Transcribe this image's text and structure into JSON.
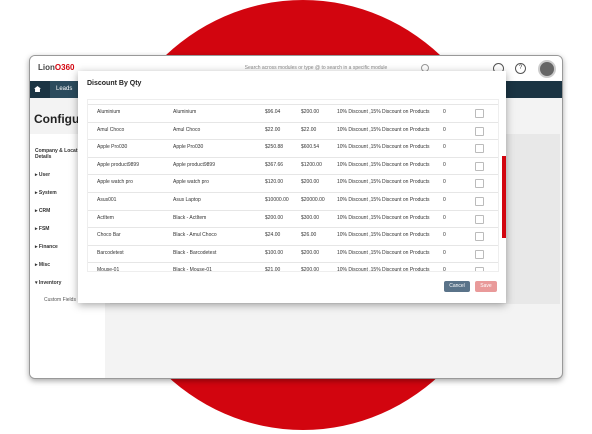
{
  "app": {
    "logo_prefix": "Lion",
    "logo_suffix": "O360",
    "search_placeholder": "Search across modules or type @ to search in a specific module",
    "help_label": "?",
    "nav_item": "Leads",
    "page_title": "Configura"
  },
  "sidebar": {
    "items": [
      {
        "label": "Company & Locat Details"
      },
      {
        "label": "User"
      },
      {
        "label": "System"
      },
      {
        "label": "CRM"
      },
      {
        "label": "FSM"
      },
      {
        "label": "Finance"
      },
      {
        "label": "Misc"
      },
      {
        "label": "Inventory"
      },
      {
        "label": "Custom Fields"
      }
    ]
  },
  "modal": {
    "title": "Discount By Qty",
    "rows": [
      {
        "name": "Aluminium",
        "alias": "Aluminium",
        "price1": "$96.04",
        "price2": "$200.00",
        "discount": "10% Discount ,15% Discount on Products",
        "qty": "0"
      },
      {
        "name": "Amul Choco",
        "alias": "Amul Choco",
        "price1": "$22.00",
        "price2": "$22.00",
        "discount": "10% Discount ,15% Discount on Products",
        "qty": "0"
      },
      {
        "name": "Apple Pro030",
        "alias": "Apple Pro030",
        "price1": "$250.88",
        "price2": "$600.54",
        "discount": "10% Discount ,15% Discount on Products",
        "qty": "0"
      },
      {
        "name": "Apple product9899",
        "alias": "Apple product9899",
        "price1": "$367.66",
        "price2": "$1200.00",
        "discount": "10% Discount ,15% Discount on Products",
        "qty": "0"
      },
      {
        "name": "Apple watch pro",
        "alias": "Apple watch pro",
        "price1": "$120.00",
        "price2": "$200.00",
        "discount": "10% Discount ,15% Discount on Products",
        "qty": "0"
      },
      {
        "name": "Asus001",
        "alias": "Asus Laptop",
        "price1": "$10000.00",
        "price2": "$20000.00",
        "discount": "10% Discount ,15% Discount on Products",
        "qty": "0"
      },
      {
        "name": "ActItem",
        "alias": "Black - ActItem",
        "price1": "$200.00",
        "price2": "$300.00",
        "discount": "10% Discount ,15% Discount on Products",
        "qty": "0"
      },
      {
        "name": "Choco Bar",
        "alias": "Black - Amul Choco",
        "price1": "$24.00",
        "price2": "$26.00",
        "discount": "10% Discount ,15% Discount on Products",
        "qty": "0"
      },
      {
        "name": "Barcodetest",
        "alias": "Black - Barcodetest",
        "price1": "$100.00",
        "price2": "$200.00",
        "discount": "10% Discount ,15% Discount on Products",
        "qty": "0"
      },
      {
        "name": "Mouse-01",
        "alias": "Black - Mouse-01",
        "price1": "$21.00",
        "price2": "$200.00",
        "discount": "10% Discount ,15% Discount on Products",
        "qty": "0"
      }
    ],
    "cancel_label": "Cancel",
    "save_label": "Save"
  },
  "colors": {
    "brand_red": "#d2050f",
    "nav_dark": "#1b3443",
    "cancel_button": "#5a7389",
    "save_button": "#e99a9a"
  }
}
